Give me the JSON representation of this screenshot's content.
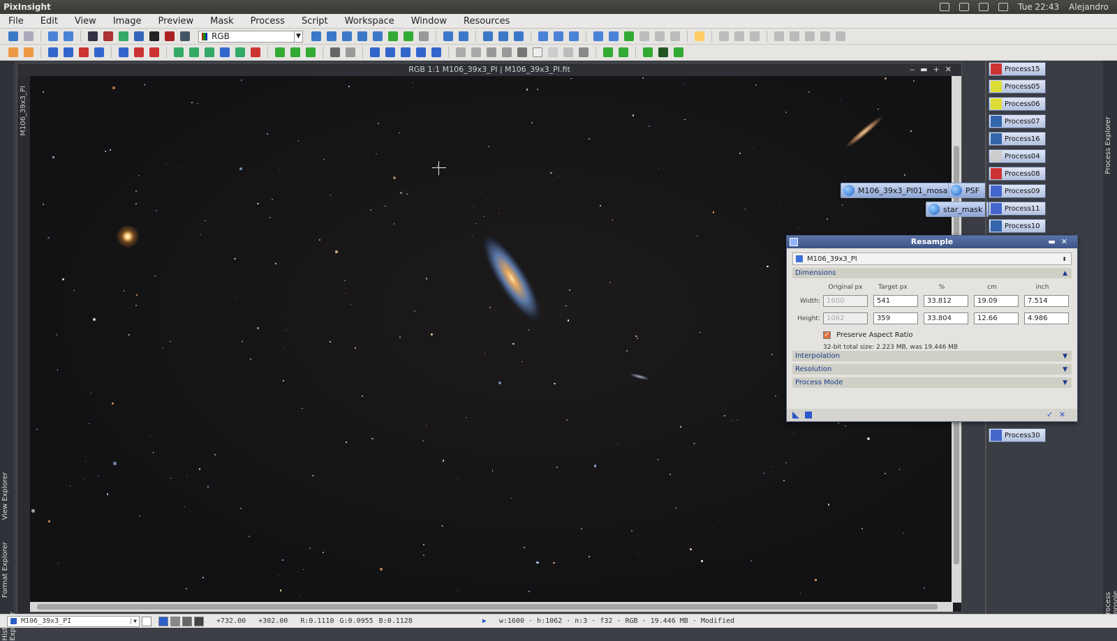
{
  "app": {
    "title": "PixInsight"
  },
  "tray": {
    "time": "Tue 22:43",
    "user": "Alejandro"
  },
  "menu": [
    "File",
    "Edit",
    "View",
    "Image",
    "Preview",
    "Mask",
    "Process",
    "Script",
    "Workspace",
    "Window",
    "Resources"
  ],
  "toolbar": {
    "color_mode": "RGB"
  },
  "image_window": {
    "title": "RGB 1:1 M106_39x3_PI | M106_39x3_PI.fit",
    "side_label": "M106_39x3_PI"
  },
  "left_panels": [
    "View Explorer",
    "Format Explorer",
    "History Explorer"
  ],
  "right_panels": [
    "Process Explorer",
    "Process Console"
  ],
  "desktop_icons": [
    {
      "label": "M106_39x3_PI01_mosaic"
    },
    {
      "label": "PSF"
    },
    {
      "label": "star_mask"
    }
  ],
  "process_icons": [
    "Process15",
    "Process05",
    "Process06",
    "Process07",
    "Process16",
    "Process04",
    "Process08",
    "Process09",
    "Process11",
    "Process10",
    "Process30"
  ],
  "resample": {
    "title": "Resample",
    "view": "M106_39x3_PI",
    "sections": {
      "dimensions": "Dimensions",
      "interpolation": "Interpolation",
      "resolution": "Resolution",
      "process_mode": "Process Mode"
    },
    "columns": [
      "Original px",
      "Target px",
      "%",
      "cm",
      "inch"
    ],
    "width": {
      "label": "Width:",
      "original": "1600",
      "target": "541",
      "percent": "33.812",
      "cm": "19.09",
      "inch": "7.514"
    },
    "height": {
      "label": "Height:",
      "original": "1062",
      "target": "359",
      "percent": "33.804",
      "cm": "12.66",
      "inch": "4.986"
    },
    "preserve_aspect": "Preserve Aspect Ratio",
    "size_info": "32-bit total size: 2.223 MB, was 19.446 MB"
  },
  "status": {
    "view": "M106_39x3_PI",
    "x": "+732.00",
    "y": "+302.00",
    "r": "R:0.1110",
    "g": "G:0.0955",
    "b": "B:0.1128",
    "info": "w:1600 · h:1062 · n:3 · f32 · RGB · 19.446 MB · Modified"
  }
}
